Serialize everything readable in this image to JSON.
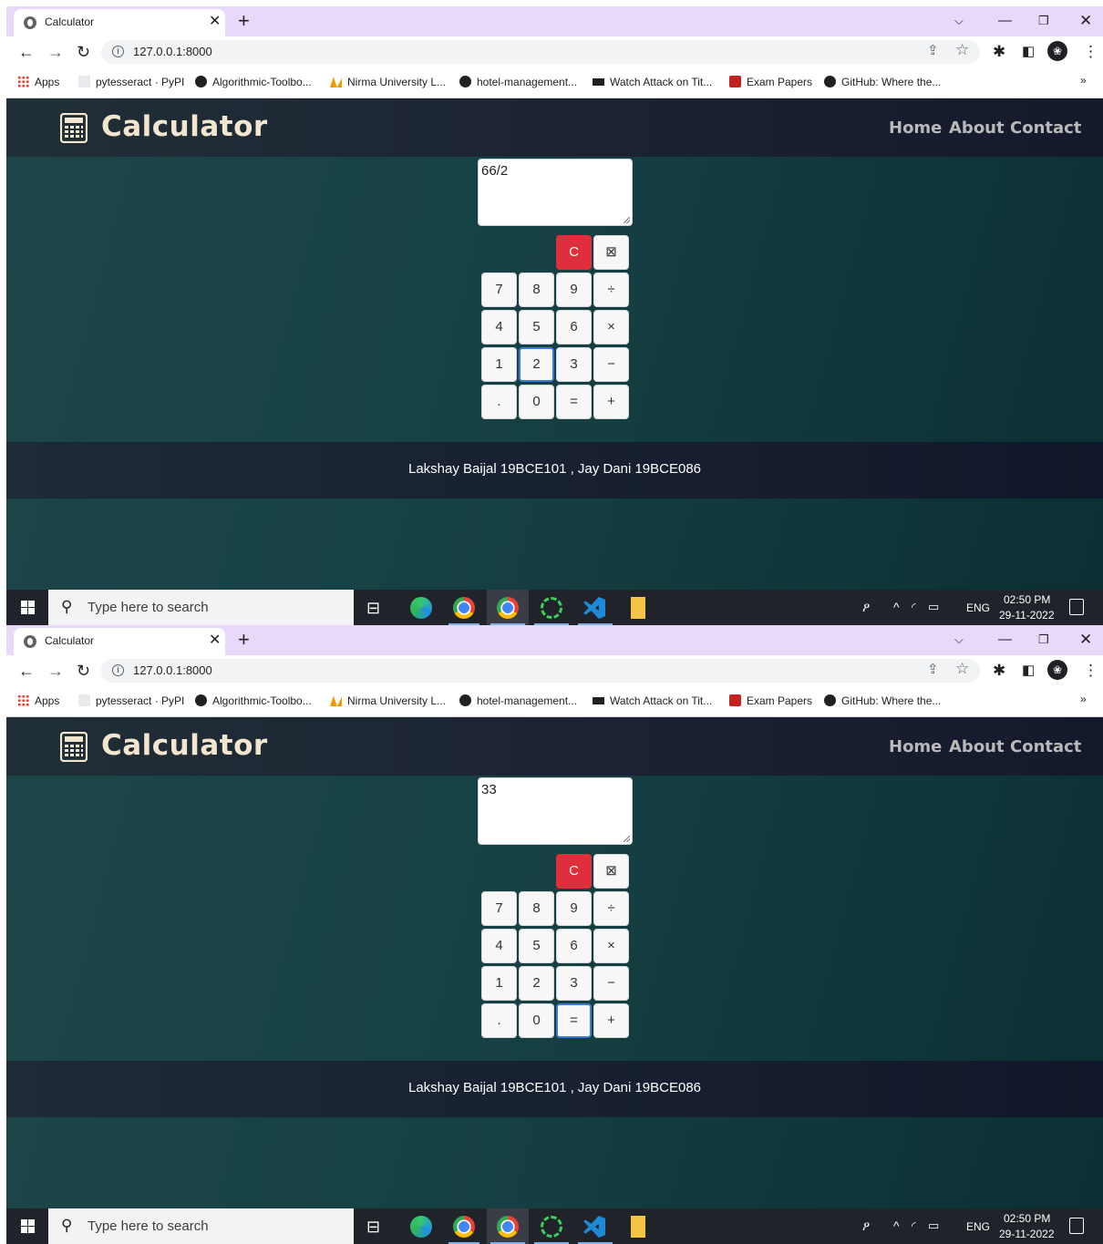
{
  "screens": [
    {
      "browser": {
        "tab_title": "Calculator",
        "url": "127.0.0.1:8000"
      },
      "display_value": "66/2",
      "focused_key": "2"
    },
    {
      "browser": {
        "tab_title": "Calculator",
        "url": "127.0.0.1:8000"
      },
      "display_value": "33",
      "focused_key": "="
    }
  ],
  "bookmarks": [
    {
      "label": "Apps",
      "icon": "apps-grid-icon"
    },
    {
      "label": "pytesseract · PyPI",
      "icon": "pypi-icon"
    },
    {
      "label": "Algorithmic-Toolbo...",
      "icon": "github-icon"
    },
    {
      "label": "Nirma University L...",
      "icon": "nirma-icon"
    },
    {
      "label": "hotel-management...",
      "icon": "github-icon"
    },
    {
      "label": "Watch Attack on Tit...",
      "icon": "aot-icon"
    },
    {
      "label": "Exam Papers",
      "icon": "exam-icon"
    },
    {
      "label": "GitHub: Where the...",
      "icon": "github-icon"
    }
  ],
  "site": {
    "brand": "Calculator",
    "nav": {
      "home": "Home",
      "about": "About",
      "contact": "Contact"
    },
    "footer": "Lakshay Baijal 19BCE101 , Jay Dani 19BCE086",
    "keys": {
      "clear": "C",
      "backspace": "⊠",
      "rows": [
        [
          "7",
          "8",
          "9",
          "÷"
        ],
        [
          "4",
          "5",
          "6",
          "×"
        ],
        [
          "1",
          "2",
          "3",
          "−"
        ],
        [
          ".",
          "0",
          "=",
          "+"
        ]
      ]
    }
  },
  "taskbar": {
    "search_placeholder": "Type here to search",
    "language": "ENG",
    "time": "02:50 PM",
    "date": "29-11-2022"
  },
  "colors": {
    "tab_strip": "#e8d9fb",
    "header_bg": "#1c2233",
    "page_bg": "#164144",
    "clear_button": "#e02f3c",
    "brand_text": "#f2e6cf"
  }
}
